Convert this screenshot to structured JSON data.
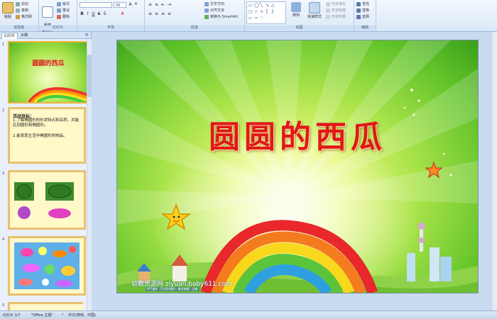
{
  "ribbon": {
    "clipboard": {
      "group_label": "剪贴板",
      "paste_label": "粘贴",
      "cut_label": "剪切",
      "copy_label": "复制",
      "format_painter_label": "格式刷"
    },
    "slides": {
      "group_label": "幻灯片",
      "new_slide_label": "新建\n幻灯片",
      "layout_label": "版式",
      "reset_label": "重设",
      "delete_label": "删除"
    },
    "font": {
      "group_label": "字体",
      "font_size_value": "48"
    },
    "paragraph": {
      "group_label": "段落",
      "text_direction_label": "文字方向",
      "align_text_label": "对齐文本",
      "smartart_label": "转换为 SmartArt"
    },
    "drawing": {
      "group_label": "绘图",
      "arrange_label": "排列",
      "quick_styles_label": "快速样式",
      "shape_fill_label": "形状填充",
      "shape_outline_label": "形状轮廓",
      "shape_effects_label": "形状效果"
    },
    "editing": {
      "group_label": "编辑",
      "find_label": "查找",
      "replace_label": "替换",
      "select_label": "选择"
    }
  },
  "panel": {
    "tab_slides": "幻灯片",
    "tab_outline": "大纲",
    "close_glyph": "×",
    "slides": [
      {
        "number": "1",
        "title": "圆圆的西瓜"
      },
      {
        "number": "2",
        "heading": "活动目标：",
        "lines": [
          "1.了解椭圆形的形状特点和名称，并能区别圆形和椭圆形。",
          "2.能发现生活中椭圆形的物品。"
        ]
      },
      {
        "number": "3"
      },
      {
        "number": "4"
      },
      {
        "number": "5"
      }
    ]
  },
  "slide": {
    "title": "圆圆的西瓜",
    "watermark": "幼教资源网 ziyuan.baby611.com",
    "watermark_sub": "PPT课件 · FLASH课件 · 教学故事 · 试卷"
  },
  "status": {
    "slide_indicator": "幻灯片 1/7",
    "theme": "\"Office 主题\"",
    "language": "中文(简体，中国)"
  },
  "colors": {
    "title_red": "#e0181a",
    "selected_border": "#f0b23a",
    "ribbon_blue": "#dbe8f7"
  }
}
